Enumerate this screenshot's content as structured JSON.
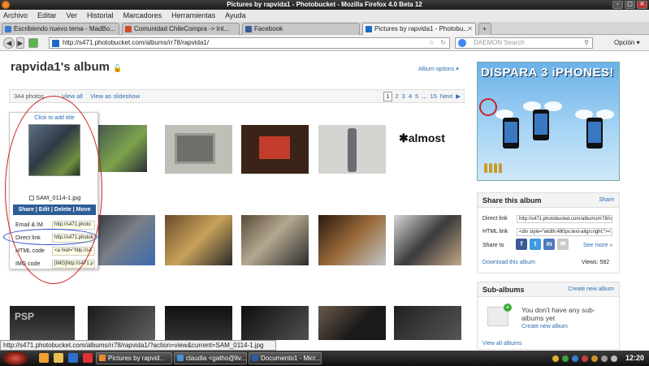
{
  "window": {
    "title": "Pictures by rapvida1 - Photobucket - Mozilla Firefox 4.0 Beta 12"
  },
  "menu": [
    "Archivo",
    "Editar",
    "Ver",
    "Historial",
    "Marcadores",
    "Herramientas",
    "Ayuda"
  ],
  "tabs": [
    {
      "label": "Escribiendo nuevo tema - MadBo...",
      "icon": "forum-icon",
      "color": "#3c7bd0"
    },
    {
      "label": "Comunidad ChileCompra -> Int...",
      "icon": "chilecompra-icon",
      "color": "#d34a2a"
    },
    {
      "label": "Facebook",
      "icon": "facebook-icon",
      "color": "#3b5998"
    },
    {
      "label": "Pictures by rapvida1 - Photobu...",
      "icon": "photobucket-icon",
      "color": "#1b6ac9",
      "active": true
    }
  ],
  "nav": {
    "url": "http://s471.photobucket.com/albums/rr78/rapvida1/",
    "search_placeholder": "DAEMON Search",
    "options_label": "Opción"
  },
  "album": {
    "title": "rapvida1's album",
    "options_label": "Album options ▾",
    "photo_count": "344 photos",
    "view_all": "View all",
    "view_slideshow": "View as slideshow",
    "pagination": {
      "current": "1",
      "pages": [
        "2",
        "3",
        "4",
        "5",
        "...",
        "15"
      ],
      "next": "Next"
    }
  },
  "popup": {
    "click_to_add": "Click to add title",
    "filename": "SAM_0114-1.jpg",
    "actions": "Share | Edit | Delete | Move",
    "rows": [
      {
        "label": "Email & IM",
        "value": "http://s471.photo"
      },
      {
        "label": "Direct link",
        "value": "http://s471.photob"
      },
      {
        "label": "HTML code",
        "value": "<a href=\"http://s4"
      },
      {
        "label": "IMG code",
        "value": "[IMG]http://s471.p"
      }
    ]
  },
  "ad": {
    "title": "DISPARA 3 iPHONES!"
  },
  "share_box": {
    "title": "Share this album",
    "share_link": "Share",
    "direct_link_label": "Direct link",
    "direct_link_value": "http://s471.photobucket.com/albums/rr78/ra",
    "html_link_label": "HTML link",
    "html_link_value": "<div style=\"width:480px;text-align:right;\"><",
    "share_to_label": "Share to",
    "see_more": "See more »",
    "download": "Download this album",
    "views": "Views: 582"
  },
  "subalbums_box": {
    "title": "Sub-albums",
    "create_link": "Create new album",
    "empty_text": "You don't have any sub-albums yet",
    "create_new": "Create new album",
    "view_all": "View all albums"
  },
  "status": {
    "text": "http://s471.photobucket.com/albums/rr78/rapvida1/?action=view&current=SAM_0114-1.jpg"
  },
  "taskbar": {
    "tasks": [
      {
        "label": "Pictures by rapvid...",
        "color": "#e8892b"
      },
      {
        "label": "claudia <gatho@liv...",
        "color": "#4a8fd8"
      },
      {
        "label": "Documento1 - Micr...",
        "color": "#2a5caa"
      }
    ],
    "clock": "12:20"
  },
  "thumbnails": [
    {
      "row": 1,
      "desc": "computer-parts-photo",
      "color1": "#3b4a4f",
      "color2": "#7da34c"
    },
    {
      "row": 1,
      "desc": "crt-monitor-gray-photo",
      "color1": "#8a8a86",
      "color2": "#5a5a55"
    },
    {
      "row": 1,
      "desc": "tv-red-screen-photo",
      "color1": "#6c3f22",
      "color2": "#2a1a12"
    },
    {
      "row": 1,
      "desc": "remote-control-photo",
      "color1": "#d9dbd8",
      "color2": "#8a8c8c"
    },
    {
      "row": 1,
      "desc": "tv-room-photo",
      "color1": "#5b3422",
      "color2": "#2a1814"
    },
    {
      "row": 1,
      "desc": "almost-logo",
      "color1": "#ffffff",
      "color2": "#111111"
    }
  ]
}
